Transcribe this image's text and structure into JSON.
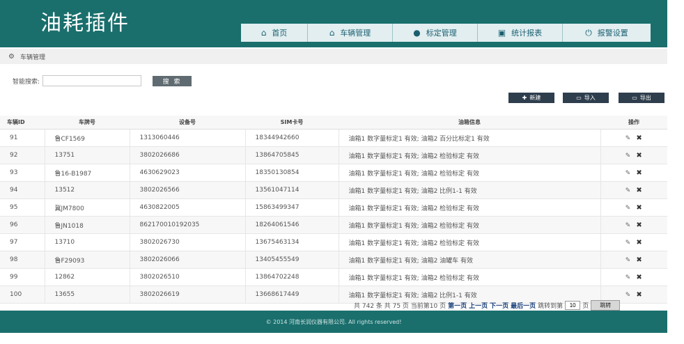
{
  "app": {
    "title": "油耗插件"
  },
  "nav": [
    {
      "label": "首页",
      "icon": "home-icon"
    },
    {
      "label": "车辆管理",
      "icon": "home-icon"
    },
    {
      "label": "标定管理",
      "icon": "user-icon"
    },
    {
      "label": "统计报表",
      "icon": "report-icon"
    },
    {
      "label": "报警设置",
      "icon": "power-icon"
    }
  ],
  "breadcrumb": {
    "label": "车辆管理",
    "icon": "gears-icon"
  },
  "search": {
    "label": "智能搜索:",
    "value": "",
    "button": "搜 索"
  },
  "actions": {
    "add": "新建",
    "import": "导入",
    "export": "导出"
  },
  "table": {
    "headers": [
      "车辆ID",
      "车牌号",
      "设备号",
      "SIM卡号",
      "油箱信息",
      "操作"
    ],
    "rows": [
      [
        "91",
        "鲁CF1569",
        "1313060446",
        "18344942660",
        "油箱1 数字量标定1 有效; 油箱2 百分比标定1 有效"
      ],
      [
        "92",
        "13751",
        "3802026686",
        "13864705845",
        "油箱1 数字量标定1 有效; 油箱2 检验标定 有效"
      ],
      [
        "93",
        "鲁16-B1987",
        "4630629023",
        "18350130854",
        "油箱1 数字量标定1 有效; 油箱2 检验标定 有效"
      ],
      [
        "94",
        "13512",
        "3802026566",
        "13561047114",
        "油箱1 数字量标定1 有效; 油箱2 比例1-1 有效"
      ],
      [
        "95",
        "冀JM7800",
        "4630822005",
        "15863499347",
        "油箱1 数字量标定1 有效; 油箱2 检验标定 有效"
      ],
      [
        "96",
        "鲁JN1018",
        "862170010192035",
        "18264061546",
        "油箱1 数字量标定1 有效; 油箱2 检验标定 有效"
      ],
      [
        "97",
        "13710",
        "3802026730",
        "13675463134",
        "油箱1 数字量标定1 有效; 油箱2 检验标定 有效"
      ],
      [
        "98",
        "鲁F29093",
        "3802026066",
        "13405455549",
        "油箱1 数字量标定1 有效; 油箱2 油罐车 有效"
      ],
      [
        "99",
        "12862",
        "3802026510",
        "13864702248",
        "油箱1 数字量标定1 有效; 油箱2 检验标定 有效"
      ],
      [
        "100",
        "13655",
        "3802026619",
        "13668617449",
        "油箱1 数字量标定1 有效; 油箱2 比例1-1 有效"
      ]
    ]
  },
  "pager": {
    "summary": "共 742 条 共 75 页 当前第10 页",
    "first": "第一页",
    "prev": "上一页",
    "next": "下一页",
    "last": "最后一页",
    "jump_label": "跳转到第",
    "page_value": "10",
    "page_suffix": "页",
    "jump_button": "跳转"
  },
  "footer": {
    "text": "© 2014 河南长润仪器有限公司. All rights reserved!"
  },
  "colors": {
    "brand": "#1a6f6d",
    "nav_bg": "#e2eef0",
    "button_dark": "#2f3e4d"
  }
}
